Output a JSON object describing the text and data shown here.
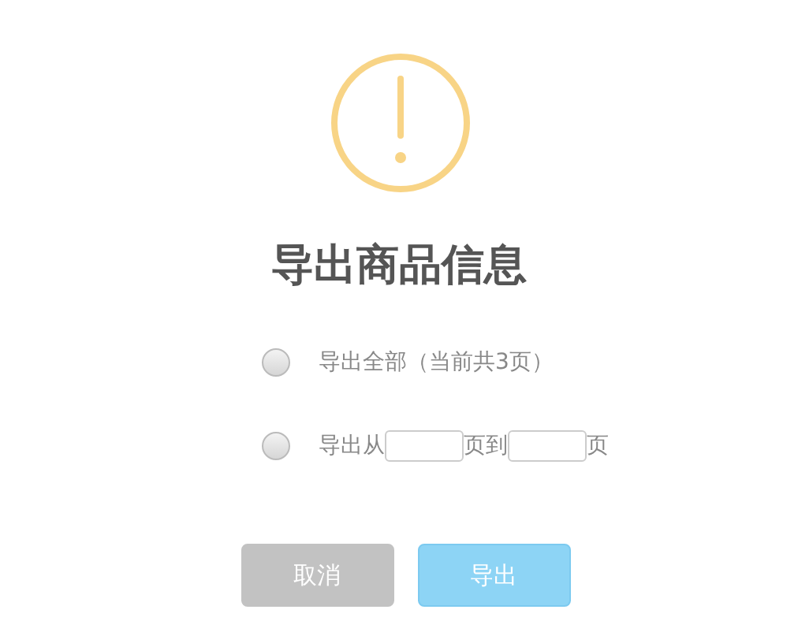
{
  "dialog": {
    "title": "导出商品信息",
    "options": [
      {
        "kind": "text",
        "label": "导出全部（当前共3页）",
        "selected": false
      },
      {
        "kind": "range",
        "parts": [
          "导出从",
          "页到",
          "页"
        ],
        "selected": false
      }
    ],
    "buttons": [
      {
        "kind": "cancel",
        "label": "取消"
      },
      {
        "kind": "primary",
        "label": "导出"
      }
    ]
  }
}
